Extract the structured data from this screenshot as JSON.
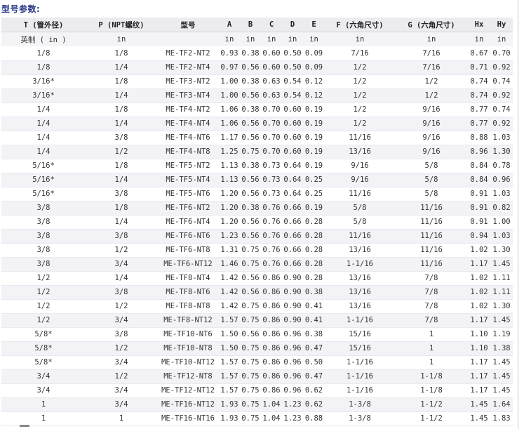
{
  "title": "型号参数:",
  "columns": [
    "T (管外径)",
    "P (NPT螺纹)",
    "型号",
    "A",
    "B",
    "C",
    "D",
    "E",
    "F (六角尺寸)",
    "G (六角尺寸)",
    "Hx",
    "Hy"
  ],
  "units": [
    "英制 ( in )",
    "in",
    "",
    "in",
    "in",
    "in",
    "in",
    "in",
    "in",
    "in",
    "in",
    "in"
  ],
  "rows": [
    [
      "1/8",
      "1/8",
      "ME-TF2-NT2",
      "0.93",
      "0.38",
      "0.60",
      "0.50",
      "0.09",
      "7/16",
      "7/16",
      "0.67",
      "0.70"
    ],
    [
      "1/8",
      "1/4",
      "ME-TF2-NT4",
      "0.97",
      "0.56",
      "0.60",
      "0.50",
      "0.09",
      "1/2",
      "7/16",
      "0.71",
      "0.92"
    ],
    [
      "3/16*",
      "1/8",
      "ME-TF3-NT2",
      "1.00",
      "0.38",
      "0.63",
      "0.54",
      "0.12",
      "1/2",
      "1/2",
      "0.74",
      "0.74"
    ],
    [
      "3/16*",
      "1/4",
      "ME-TF3-NT4",
      "1.00",
      "0.56",
      "0.63",
      "0.54",
      "0.12",
      "1/2",
      "1/2",
      "0.74",
      "0.92"
    ],
    [
      "1/4",
      "1/8",
      "ME-TF4-NT2",
      "1.06",
      "0.38",
      "0.70",
      "0.60",
      "0.19",
      "1/2",
      "9/16",
      "0.77",
      "0.74"
    ],
    [
      "1/4",
      "1/4",
      "ME-TF4-NT4",
      "1.06",
      "0.56",
      "0.70",
      "0.60",
      "0.19",
      "1/2",
      "9/16",
      "0.77",
      "0.92"
    ],
    [
      "1/4",
      "3/8",
      "ME-TF4-NT6",
      "1.17",
      "0.56",
      "0.70",
      "0.60",
      "0.19",
      "11/16",
      "9/16",
      "0.88",
      "1.03"
    ],
    [
      "1/4",
      "1/2",
      "ME-TF4-NT8",
      "1.25",
      "0.75",
      "0.70",
      "0.60",
      "0.19",
      "13/16",
      "9/16",
      "0.96",
      "1.30"
    ],
    [
      "5/16*",
      "1/8",
      "ME-TF5-NT2",
      "1.13",
      "0.38",
      "0.73",
      "0.64",
      "0.19",
      "9/16",
      "5/8",
      "0.84",
      "0.78"
    ],
    [
      "5/16*",
      "1/4",
      "ME-TF5-NT4",
      "1.13",
      "0.56",
      "0.73",
      "0.64",
      "0.25",
      "9/16",
      "5/8",
      "0.84",
      "0.96"
    ],
    [
      "5/16*",
      "3/8",
      "ME-TF5-NT6",
      "1.20",
      "0.56",
      "0.73",
      "0.64",
      "0.25",
      "11/16",
      "5/8",
      "0.91",
      "1.03"
    ],
    [
      "3/8",
      "1/8",
      "ME-TF6-NT2",
      "1.20",
      "0.38",
      "0.76",
      "0.66",
      "0.19",
      "5/8",
      "11/16",
      "0.91",
      "0.82"
    ],
    [
      "3/8",
      "1/4",
      "ME-TF6-NT4",
      "1.20",
      "0.56",
      "0.76",
      "0.66",
      "0.28",
      "5/8",
      "11/16",
      "0.91",
      "1.00"
    ],
    [
      "3/8",
      "3/8",
      "ME-TF6-NT6",
      "1.23",
      "0.56",
      "0.76",
      "0.66",
      "0.28",
      "11/16",
      "11/16",
      "0.94",
      "1.03"
    ],
    [
      "3/8",
      "1/2",
      "ME-TF6-NT8",
      "1.31",
      "0.75",
      "0.76",
      "0.66",
      "0.28",
      "13/16",
      "11/16",
      "1.02",
      "1.30"
    ],
    [
      "3/8",
      "3/4",
      "ME-TF6-NT12",
      "1.46",
      "0.75",
      "0.76",
      "0.66",
      "0.28",
      "1-1/16",
      "11/16",
      "1.17",
      "1.45"
    ],
    [
      "1/2",
      "1/4",
      "ME-TF8-NT4",
      "1.42",
      "0.56",
      "0.86",
      "0.90",
      "0.28",
      "13/16",
      "7/8",
      "1.02",
      "1.11"
    ],
    [
      "1/2",
      "3/8",
      "ME-TF8-NT6",
      "1.42",
      "0.56",
      "0.86",
      "0.90",
      "0.38",
      "13/16",
      "7/8",
      "1.02",
      "1.11"
    ],
    [
      "1/2",
      "1/2",
      "ME-TF8-NT8",
      "1.42",
      "0.75",
      "0.86",
      "0.90",
      "0.41",
      "13/16",
      "7/8",
      "1.02",
      "1.30"
    ],
    [
      "1/2",
      "3/4",
      "ME-TF8-NT12",
      "1.57",
      "0.75",
      "0.86",
      "0.90",
      "0.41",
      "1-1/16",
      "7/8",
      "1.17",
      "1.45"
    ],
    [
      "5/8*",
      "3/8",
      "ME-TF10-NT6",
      "1.50",
      "0.56",
      "0.86",
      "0.96",
      "0.38",
      "15/16",
      "1",
      "1.10",
      "1.19"
    ],
    [
      "5/8*",
      "1/2",
      "ME-TF10-NT8",
      "1.50",
      "0.75",
      "0.86",
      "0.96",
      "0.47",
      "15/16",
      "1",
      "1.10",
      "1.38"
    ],
    [
      "5/8*",
      "3/4",
      "ME-TF10-NT12",
      "1.57",
      "0.75",
      "0.86",
      "0.96",
      "0.50",
      "1-1/16",
      "1",
      "1.17",
      "1.45"
    ],
    [
      "3/4",
      "1/2",
      "ME-TF12-NT8",
      "1.57",
      "0.75",
      "0.86",
      "0.96",
      "0.47",
      "1-1/16",
      "1-1/8",
      "1.17",
      "1.45"
    ],
    [
      "3/4",
      "3/4",
      "ME-TF12-NT12",
      "1.57",
      "0.75",
      "0.86",
      "0.96",
      "0.62",
      "1-1/16",
      "1-1/8",
      "1.17",
      "1.45"
    ],
    [
      "1",
      "3/4",
      "ME-TF16-NT12",
      "1.93",
      "0.75",
      "1.04",
      "1.23",
      "0.62",
      "1-3/8",
      "1-1/2",
      "1.45",
      "1.64"
    ],
    [
      "1",
      "1",
      "ME-TF16-NT16",
      "1.93",
      "0.75",
      "1.04",
      "1.23",
      "0.88",
      "1-3/8",
      "1-1/2",
      "1.45",
      "1.83"
    ]
  ]
}
